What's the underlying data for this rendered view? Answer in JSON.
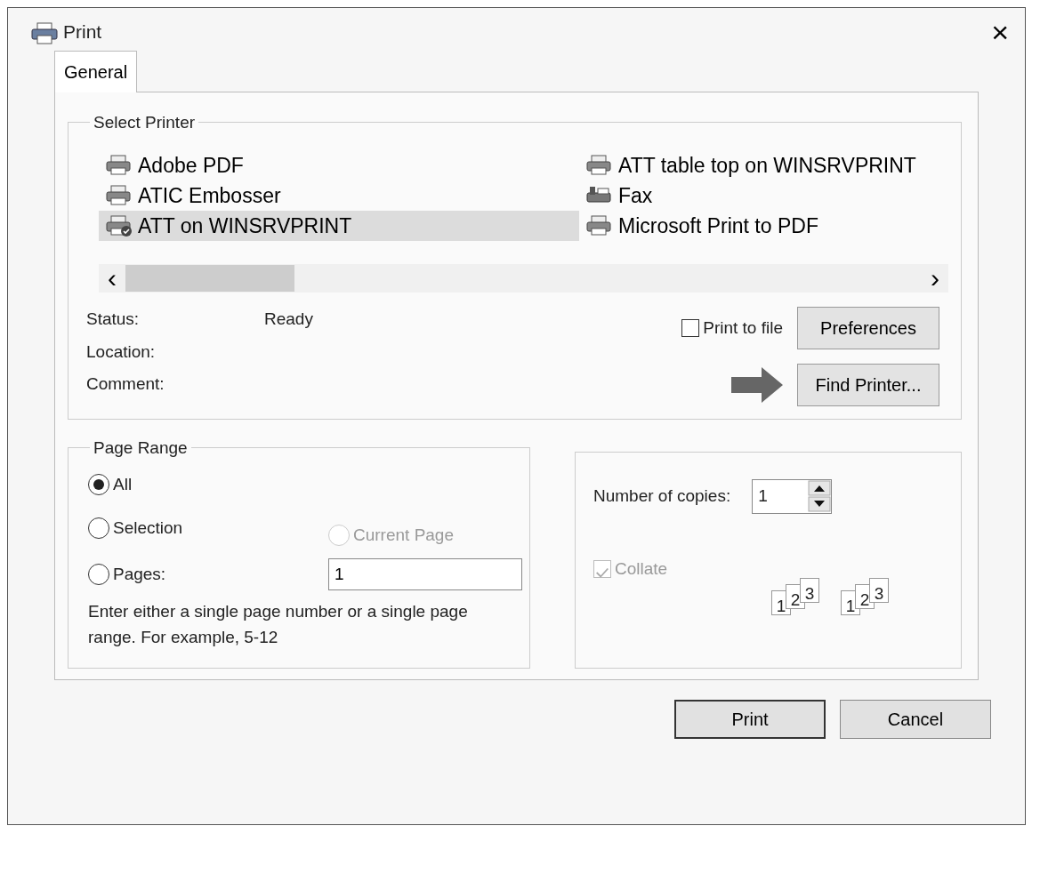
{
  "window": {
    "title": "Print",
    "close": "×"
  },
  "tabs": [
    {
      "label": "General",
      "selected": true
    }
  ],
  "select_printer": {
    "title": "Select Printer",
    "printers": [
      {
        "name": "Adobe PDF",
        "kind": "printer",
        "selected": false,
        "default": false
      },
      {
        "name": "ATIC Embosser",
        "kind": "printer",
        "selected": false,
        "default": false
      },
      {
        "name": "ATT on WINSRVPRINT",
        "kind": "printer",
        "selected": true,
        "default": true
      },
      {
        "name": "ATT table top on WINSRVPRINT",
        "kind": "printer",
        "selected": false,
        "default": false
      },
      {
        "name": "Fax",
        "kind": "fax",
        "selected": false,
        "default": false
      },
      {
        "name": "Microsoft Print to PDF",
        "kind": "printer",
        "selected": false,
        "default": false
      }
    ],
    "scroll_left": "‹",
    "scroll_right": "›",
    "info": [
      {
        "label": "Status:",
        "value": "Ready"
      },
      {
        "label": "Location:"
      },
      {
        "label": "Comment:"
      }
    ],
    "print_to_file": {
      "label": "Print to file",
      "checked": false
    },
    "buttons": [
      "Preferences",
      "Find Printer..."
    ]
  },
  "page_range": {
    "title": "Page Range",
    "options": [
      {
        "label": "All",
        "selected": true,
        "disabled": false
      },
      {
        "label": "Selection",
        "selected": false,
        "disabled": false
      },
      {
        "label": "Current Page",
        "selected": false,
        "disabled": true
      },
      {
        "label": "Pages:",
        "selected": false,
        "disabled": false
      }
    ],
    "pages_value": "1",
    "hint": "Enter either a single page number or a single page range.  For example, 5-12"
  },
  "copies": {
    "label": "Number of copies:",
    "value": "1",
    "collate": {
      "label": "Collate",
      "checked": true,
      "disabled": true
    },
    "collate_pages": [
      [
        "1",
        "2",
        "3"
      ],
      [
        "1",
        "2",
        "3"
      ]
    ]
  },
  "buttons": [
    "Print",
    "Cancel"
  ]
}
